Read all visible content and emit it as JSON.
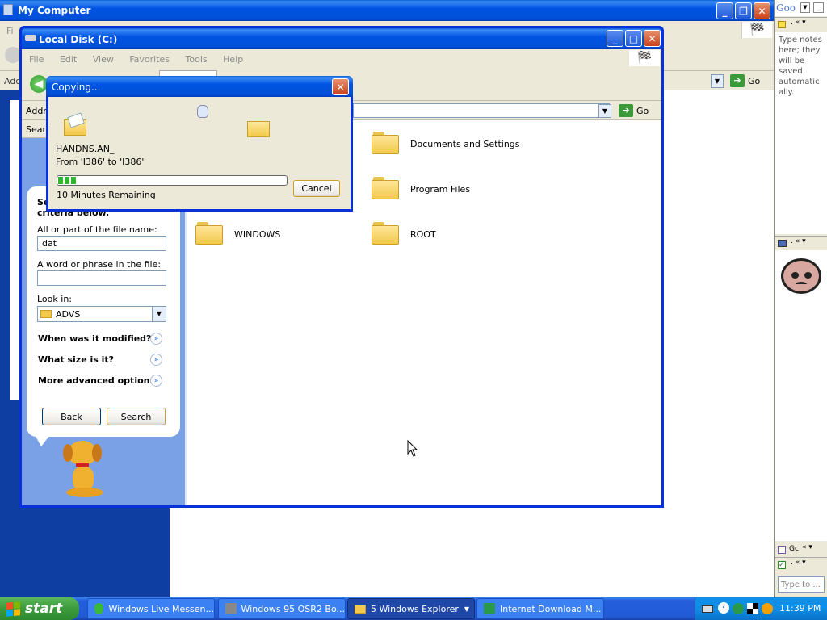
{
  "desktop_window": {
    "title": "My Computer",
    "menu_first": "Fi",
    "address_label": "Add",
    "go_label": "Go"
  },
  "explorer": {
    "title": "Local Disk (C:)",
    "menu": [
      "File",
      "Edit",
      "View",
      "Favorites",
      "Tools",
      "Help"
    ],
    "address_label": "Addr",
    "search_label": "Searc",
    "go_label": "Go",
    "folders": [
      {
        "name": "Documents and Settings"
      },
      {
        "name": "Program Files"
      },
      {
        "name": "WINDOWS"
      },
      {
        "name": "ROOT"
      }
    ]
  },
  "search_panel": {
    "heading_line1": "Se",
    "heading_line2": "criteria below.",
    "file_name_label": "All or part of the file name:",
    "file_name_value": "dat",
    "phrase_label": "A word or phrase in the file:",
    "phrase_value": "",
    "look_in_label": "Look in:",
    "look_in_value": "ADVS",
    "options": [
      "When was it modified?",
      "What size is it?",
      "More advanced options"
    ],
    "back_label": "Back",
    "search_label": "Search"
  },
  "copy_dialog": {
    "title": "Copying...",
    "file_name": "HANDNS.AN_",
    "from_to": "From 'I386' to 'I386'",
    "progress_fraction": 0.08,
    "remaining": "10 Minutes Remaining",
    "cancel_label": "Cancel"
  },
  "sidebar": {
    "logo_text": "Goo",
    "notes_text": "Type notes here; they will be saved automatically.",
    "todo_placeholder": "Type to ...",
    "gadget_label": "Gc"
  },
  "taskbar": {
    "start_label": "start",
    "items": [
      {
        "label": "Windows Live Messen..."
      },
      {
        "label": "Windows 95 OSR2 Bo..."
      },
      {
        "label": "5 Windows Explorer"
      },
      {
        "label": "Internet Download M..."
      }
    ],
    "clock": "11:39 PM"
  },
  "colors": {
    "xp_blue": "#0054e3",
    "task_pane": "#7aa1e6",
    "taskbar": "#245edb",
    "start": "#3c9a3c"
  }
}
